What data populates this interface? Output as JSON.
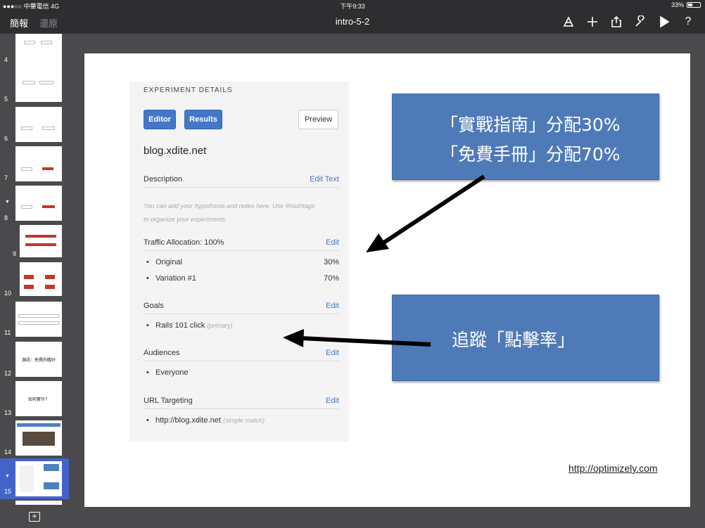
{
  "status_bar": {
    "carrier": "●●●○○ 中華電信  4G",
    "time": "下午9:33",
    "battery": "33%"
  },
  "nav": {
    "presentations_button": "簡報",
    "undo_button": "還原",
    "title": "intro-5-2"
  },
  "icons": [
    "format-brush-icon",
    "plus-icon",
    "share-icon",
    "wrench-icon",
    "play-icon",
    "help-icon"
  ],
  "sidebar": {
    "slides": [
      {
        "num": "4"
      },
      {
        "num": "5"
      },
      {
        "num": "6"
      },
      {
        "num": "7"
      },
      {
        "num": "8"
      },
      {
        "num": "9"
      },
      {
        "num": "10"
      },
      {
        "num": "11"
      },
      {
        "num": "12",
        "text": "源訊：免費的贈好"
      },
      {
        "num": "13",
        "text": "如何實作？"
      },
      {
        "num": "14"
      },
      {
        "num": "15"
      }
    ]
  },
  "slide": {
    "panel": {
      "header": "EXPERIMENT DETAILS",
      "editor_button": "Editor",
      "results_button": "Results",
      "preview_button": "Preview",
      "site": "blog.xdite.net",
      "description": {
        "label": "Description",
        "edit": "Edit Text",
        "placeholder_line1": "You can add your hypothesis and notes here. Use #hashtags",
        "placeholder_line2": "to organize your experiments."
      },
      "traffic": {
        "label": "Traffic Allocation: 100%",
        "edit": "Edit",
        "items": [
          {
            "name": "Original",
            "value": "30%"
          },
          {
            "name": "Variation #1",
            "value": "70%"
          }
        ]
      },
      "goals": {
        "label": "Goals",
        "edit": "Edit",
        "item": "Rails 101 click",
        "item_note": "(primary)"
      },
      "audiences": {
        "label": "Audiences",
        "edit": "Edit",
        "item": "Everyone"
      },
      "url_targeting": {
        "label": "URL Targeting",
        "edit": "Edit",
        "item": "http://blog.xdite.net",
        "item_note": "(simple match)"
      }
    },
    "callout_top": {
      "line1": "「實戰指南」分配30%",
      "line2": "「免費手冊」分配70%"
    },
    "callout_bottom": {
      "line1": "追蹤「點擊率」"
    },
    "link": "http://optimizely.com"
  }
}
